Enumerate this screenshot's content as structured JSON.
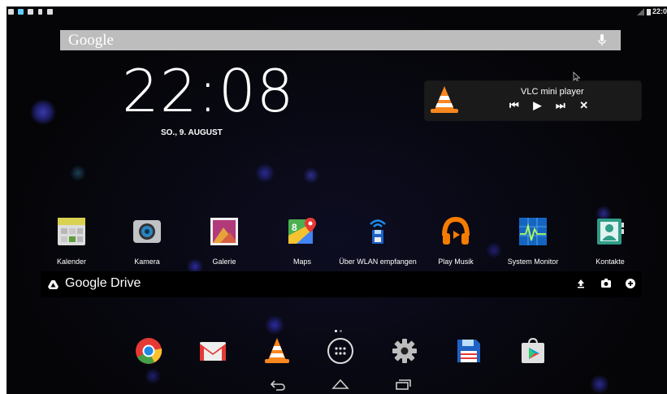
{
  "search": {
    "logo": "Google"
  },
  "clock": {
    "time": "22:08",
    "date": "SO., 9. AUGUST"
  },
  "vlc": {
    "title": "VLC mini player",
    "prev": "⏮",
    "play": "▶",
    "next": "⏭",
    "close": "✕"
  },
  "apps": [
    {
      "label": "Kalender",
      "icon": "calendar-icon"
    },
    {
      "label": "Kamera",
      "icon": "camera-icon"
    },
    {
      "label": "Galerie",
      "icon": "gallery-icon"
    },
    {
      "label": "Maps",
      "icon": "maps-icon"
    },
    {
      "label": "Über WLAN empfangen",
      "icon": "wifi-receive-icon"
    },
    {
      "label": "Play Musik",
      "icon": "headphones-icon"
    },
    {
      "label": "System Monitor",
      "icon": "system-monitor-icon"
    },
    {
      "label": "Kontakte",
      "icon": "contacts-icon"
    }
  ],
  "drive": {
    "label": "Google Drive"
  },
  "status": {
    "time": "22:0"
  },
  "dock": [
    {
      "icon": "chrome-icon"
    },
    {
      "icon": "gmail-icon"
    },
    {
      "icon": "vlc-icon"
    },
    {
      "icon": "app-drawer-icon"
    },
    {
      "icon": "settings-icon"
    },
    {
      "icon": "save-icon"
    },
    {
      "icon": "play-store-icon"
    }
  ]
}
